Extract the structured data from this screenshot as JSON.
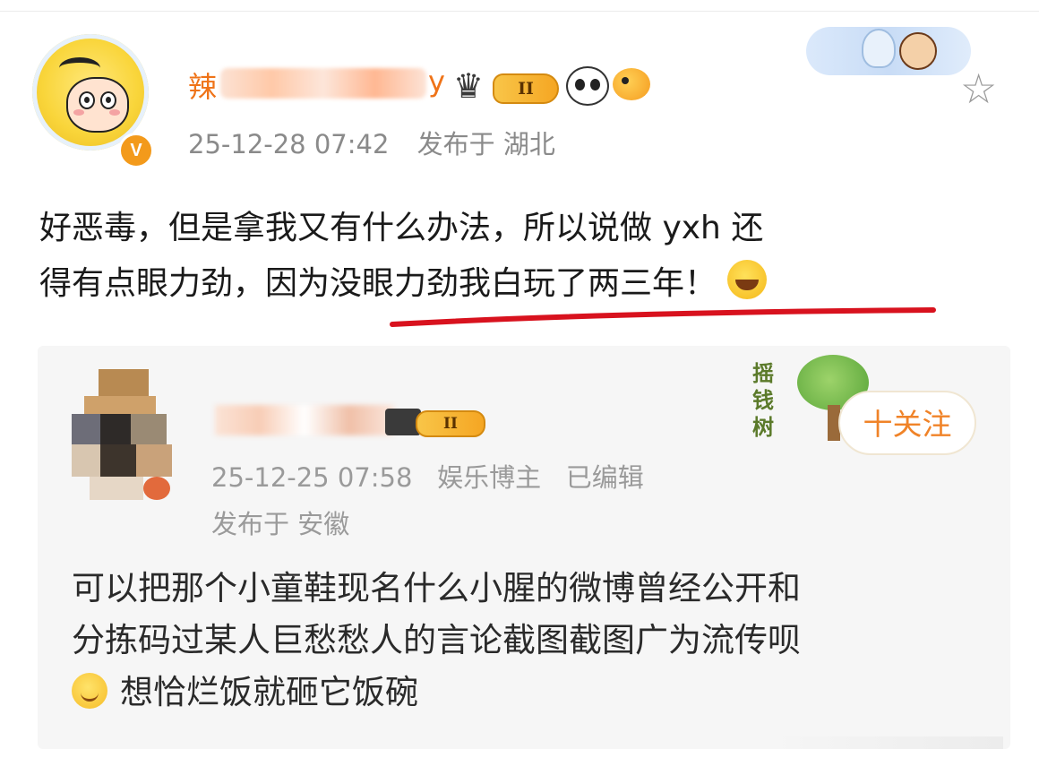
{
  "post": {
    "username": "辣",
    "username_tail": "y",
    "level_badge": "II",
    "timestamp": "25-12-28 07:42",
    "location_label": "发布于 湖北",
    "text_line1": "好恶毒，但是拿我又有什么办法，所以说做 yxh 还",
    "text_line2": "得有点眼力劲，因为没眼力劲我白玩了两三年！",
    "verified_badge": "V"
  },
  "repost": {
    "level_badge": "II",
    "meta_line1": "25-12-25 07:58   娱乐博主   已编辑",
    "meta_line2": "发布于 安徽",
    "follow_label": "十关注",
    "tree_text": "摇钱树",
    "text_line1": "可以把那个小童鞋现名什么小腥的微博曾经公开和",
    "text_line2": "分拣码过某人巨愁愁人的言论截图截图广为流传呗",
    "text_line3": "想恰烂饭就砸它饭碗"
  },
  "colors": {
    "username": "#ef7318",
    "meta": "#8a8a8a",
    "underline": "#d8121e",
    "follow": "#f08328"
  }
}
